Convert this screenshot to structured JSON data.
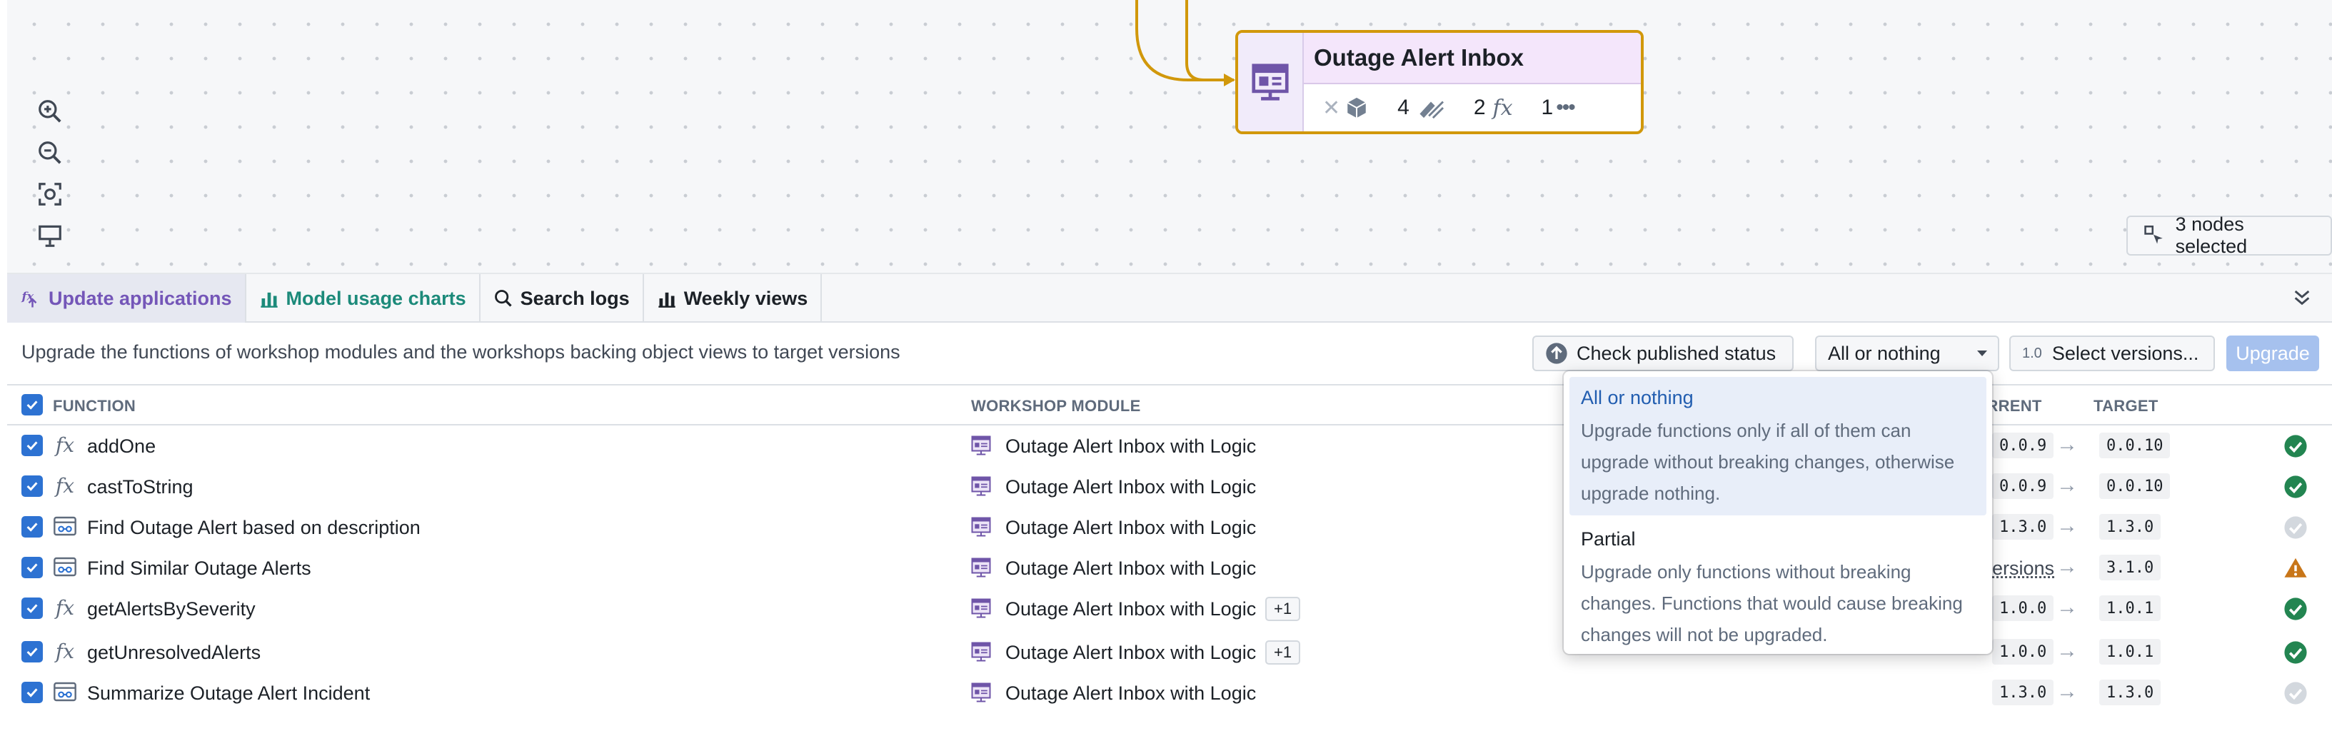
{
  "node": {
    "title": "Outage Alert Inbox",
    "stats": [
      {
        "icon": "object-type-icon",
        "count": ""
      },
      {
        "icon": "action-icon",
        "count": "4"
      },
      {
        "icon": "function-icon",
        "count": "2"
      },
      {
        "icon": "more-icon",
        "count": "1"
      }
    ]
  },
  "canvas": {
    "nodes_selected": "3 nodes selected",
    "controls": [
      "zoom-in-icon",
      "zoom-out-icon",
      "fit-view-icon",
      "present-icon"
    ]
  },
  "tabs": [
    {
      "label": "Update applications",
      "icon": "function-icon"
    },
    {
      "label": "Model usage charts",
      "icon": "bar-chart-icon"
    },
    {
      "label": "Search logs",
      "icon": "search-icon"
    },
    {
      "label": "Weekly views",
      "icon": "bar-chart-icon"
    }
  ],
  "toolbar": {
    "description": "Upgrade the functions of workshop modules and the workshops backing object views to target versions",
    "check_status": "Check published status",
    "mode_selected": "All or nothing",
    "version_tag": "1.0",
    "select_versions": "Select versions...",
    "upgrade": "Upgrade"
  },
  "table": {
    "headers": {
      "function": "FUNCTION",
      "workshop": "WORKSHOP MODULE",
      "current": "CURRENT",
      "target": "TARGET"
    },
    "rows": [
      {
        "function": "addOne",
        "type": "function",
        "workshop": "Outage Alert Inbox with Logic",
        "more": "",
        "current": "0.0.9",
        "target": "0.0.10",
        "status": "ok"
      },
      {
        "function": "castToString",
        "type": "function",
        "workshop": "Outage Alert Inbox with Logic",
        "more": "",
        "current": "0.0.9",
        "target": "0.0.10",
        "status": "ok"
      },
      {
        "function": "Find Outage Alert based on description",
        "type": "logic",
        "workshop": "Outage Alert Inbox with Logic",
        "more": "",
        "current": "1.3.0",
        "target": "1.3.0",
        "status": "neutral"
      },
      {
        "function": "Find Similar Outage Alerts",
        "type": "logic",
        "workshop": "Outage Alert Inbox with Logic",
        "more": "",
        "current": "ersions",
        "target": "3.1.0",
        "status": "warning"
      },
      {
        "function": "getAlertsBySeverity",
        "type": "function",
        "workshop": "Outage Alert Inbox with Logic",
        "more": "+1",
        "current": "1.0.0",
        "target": "1.0.1",
        "status": "ok"
      },
      {
        "function": "getUnresolvedAlerts",
        "type": "function",
        "workshop": "Outage Alert Inbox with Logic",
        "more": "+1",
        "current": "1.0.0",
        "target": "1.0.1",
        "status": "ok"
      },
      {
        "function": "Summarize Outage Alert Incident",
        "type": "logic",
        "workshop": "Outage Alert Inbox with Logic",
        "more": "",
        "current": "1.3.0",
        "target": "1.3.0",
        "status": "neutral"
      }
    ]
  },
  "dropdown": {
    "options": [
      {
        "title": "All or nothing",
        "description": "Upgrade functions only if all of them can upgrade without breaking changes, otherwise upgrade nothing."
      },
      {
        "title": "Partial",
        "description": "Upgrade only functions without breaking changes. Functions that would cause breaking changes will not be upgraded."
      }
    ]
  },
  "colors": {
    "accent": "#2d72d2",
    "node_border": "#d1980b",
    "success": "#238551",
    "warning": "#c87619",
    "tab_active": "#7456b8"
  }
}
